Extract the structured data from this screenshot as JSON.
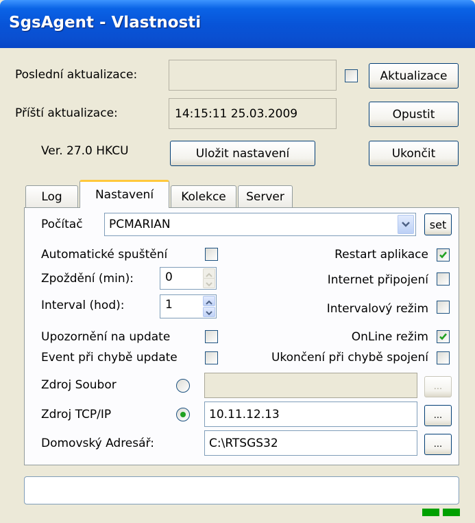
{
  "window": {
    "title": "SgsAgent - Vlastnosti"
  },
  "header": {
    "last_update_label": "Poslední aktualizace:",
    "last_update_value": "",
    "next_update_label": "Příští aktualizace:",
    "next_update_value": "14:15:11   25.03.2009",
    "version": "Ver. 27.0 HKCU",
    "update_checkbox_checked": false,
    "buttons": {
      "update": "Aktualizace",
      "leave": "Opustit",
      "save": "Uložit nastavení",
      "exit": "Ukončit"
    }
  },
  "tabs": [
    {
      "label": "Log",
      "active": false
    },
    {
      "label": "Nastavení",
      "active": true
    },
    {
      "label": "Kolekce",
      "active": false
    },
    {
      "label": "Server",
      "active": false
    }
  ],
  "settings": {
    "computer_label": "Počítač",
    "computer_value": "PCMARIAN",
    "set_button": "set",
    "auto_start_label": "Automatické spuštění",
    "auto_start": false,
    "delay_label": "Zpoždění (min):",
    "delay_value": "0",
    "interval_label": "Interval (hod):",
    "interval_value": "1",
    "notify_update_label": "Upozornění na update",
    "notify_update": false,
    "event_error_label": "Event při chybě update",
    "event_error": false,
    "restart_app_label": "Restart aplikace",
    "restart_app": true,
    "internet_label": "Internet připojení",
    "internet": false,
    "interval_mode_label": "Intervalový režim",
    "interval_mode": false,
    "online_mode_label": "OnLine režim",
    "online_mode": true,
    "exit_on_error_label": "Ukončení při chybě spojení",
    "exit_on_error": false,
    "source_file_label": "Zdroj Soubor",
    "source_file_value": "",
    "source_tcp_label": "Zdroj TCP/IP",
    "source_tcp_value": "10.11.12.13",
    "home_dir_label": "Domovský Adresář:",
    "home_dir_value": "C:\\RTSGS32",
    "browse_label": "...",
    "source_selected": "tcp"
  },
  "colors": {
    "titlebar": "#0a5bdc",
    "face": "#ece9d8",
    "check": "#21a121",
    "tab_accent": "#ffc83c",
    "led": "#00a000"
  }
}
